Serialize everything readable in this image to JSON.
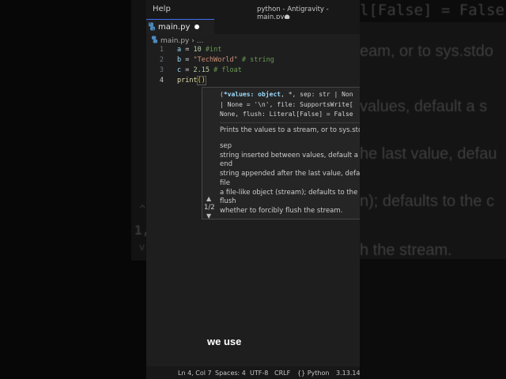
{
  "window": {
    "menu": "Help",
    "title": "python - Antigravity - main.py●"
  },
  "tab": {
    "label": "main.py",
    "icon": "python-icon"
  },
  "breadcrumb": {
    "file": "main.py",
    "more": "..."
  },
  "editor": {
    "line_numbers": [
      "1",
      "2",
      "3",
      "4"
    ],
    "lines": [
      {
        "var": "a",
        "op": " = ",
        "val": "10",
        "comment": " #int"
      },
      {
        "var": "b",
        "op": " = ",
        "val": "\"TechWorld\"",
        "comment": " # string"
      },
      {
        "var": "c",
        "op": " = ",
        "val": "2.15",
        "comment": " # float"
      },
      {
        "fn": "print",
        "paren": "()"
      }
    ]
  },
  "signature_help": {
    "overload": "1/2",
    "sig_line1_active": "*values: object",
    "sig_line1_rest": ", *, sep: str | Non",
    "sig_open": "(",
    "sig_line2": "| None = '\\n', file: SupportsWrite[",
    "sig_line3": "None, flush: Literal[False] = False",
    "description": "Prints the values to a stream, or to sys.stdou",
    "params": [
      {
        "name": "sep",
        "desc": " string inserted between values, default a s"
      },
      {
        "name": "end",
        "desc": " string appended after the last value, defau"
      },
      {
        "name": "file",
        "desc": " a file-like object (stream); defaults to the c"
      },
      {
        "name": "flush",
        "desc": " whether to forcibly flush the stream."
      }
    ]
  },
  "caption": "we use",
  "statusbar": {
    "position": "Ln 4, Col 7",
    "spaces": "Spaces: 4",
    "encoding": "UTF-8",
    "eol": "CRLF",
    "language": "{} Python",
    "version": "3.13.14 ("
  },
  "background_right": {
    "line1": "l[False] = False",
    "line2": "eam, or to sys.stdo",
    "line3": "values, default a s",
    "line4": "he last value, defau",
    "line5": "n); defaults to the c",
    "line6": "h the stream."
  },
  "background_left": {
    "glyph1": "^",
    "glyph2": "1,",
    "glyph3": "v"
  },
  "colors": {
    "accent": "#3a6df0",
    "editor_bg": "#1e1e1e",
    "string": "#ce9178",
    "comment": "#6a9955"
  }
}
